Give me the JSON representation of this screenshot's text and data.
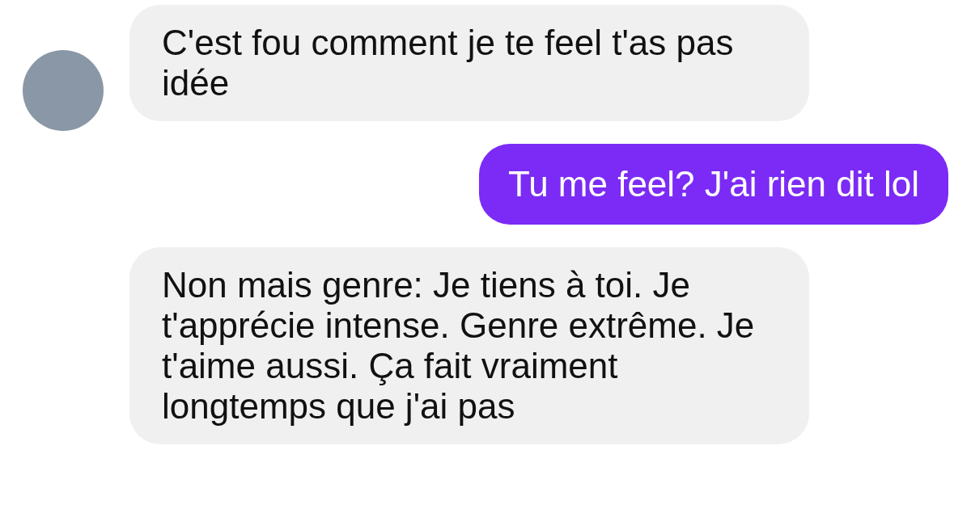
{
  "messages": [
    {
      "kind": "received",
      "avatar": true,
      "text": "C'est fou comment je te feel t'as pas idée"
    },
    {
      "kind": "sent",
      "text": "Tu me feel? J'ai rien dit lol"
    },
    {
      "kind": "received",
      "avatar": false,
      "text": "Non mais genre: Je tiens à toi. Je t'apprécie intense. Genre extrême. Je t'aime aussi. Ça fait vraiment longtemps que j'ai pas"
    }
  ]
}
